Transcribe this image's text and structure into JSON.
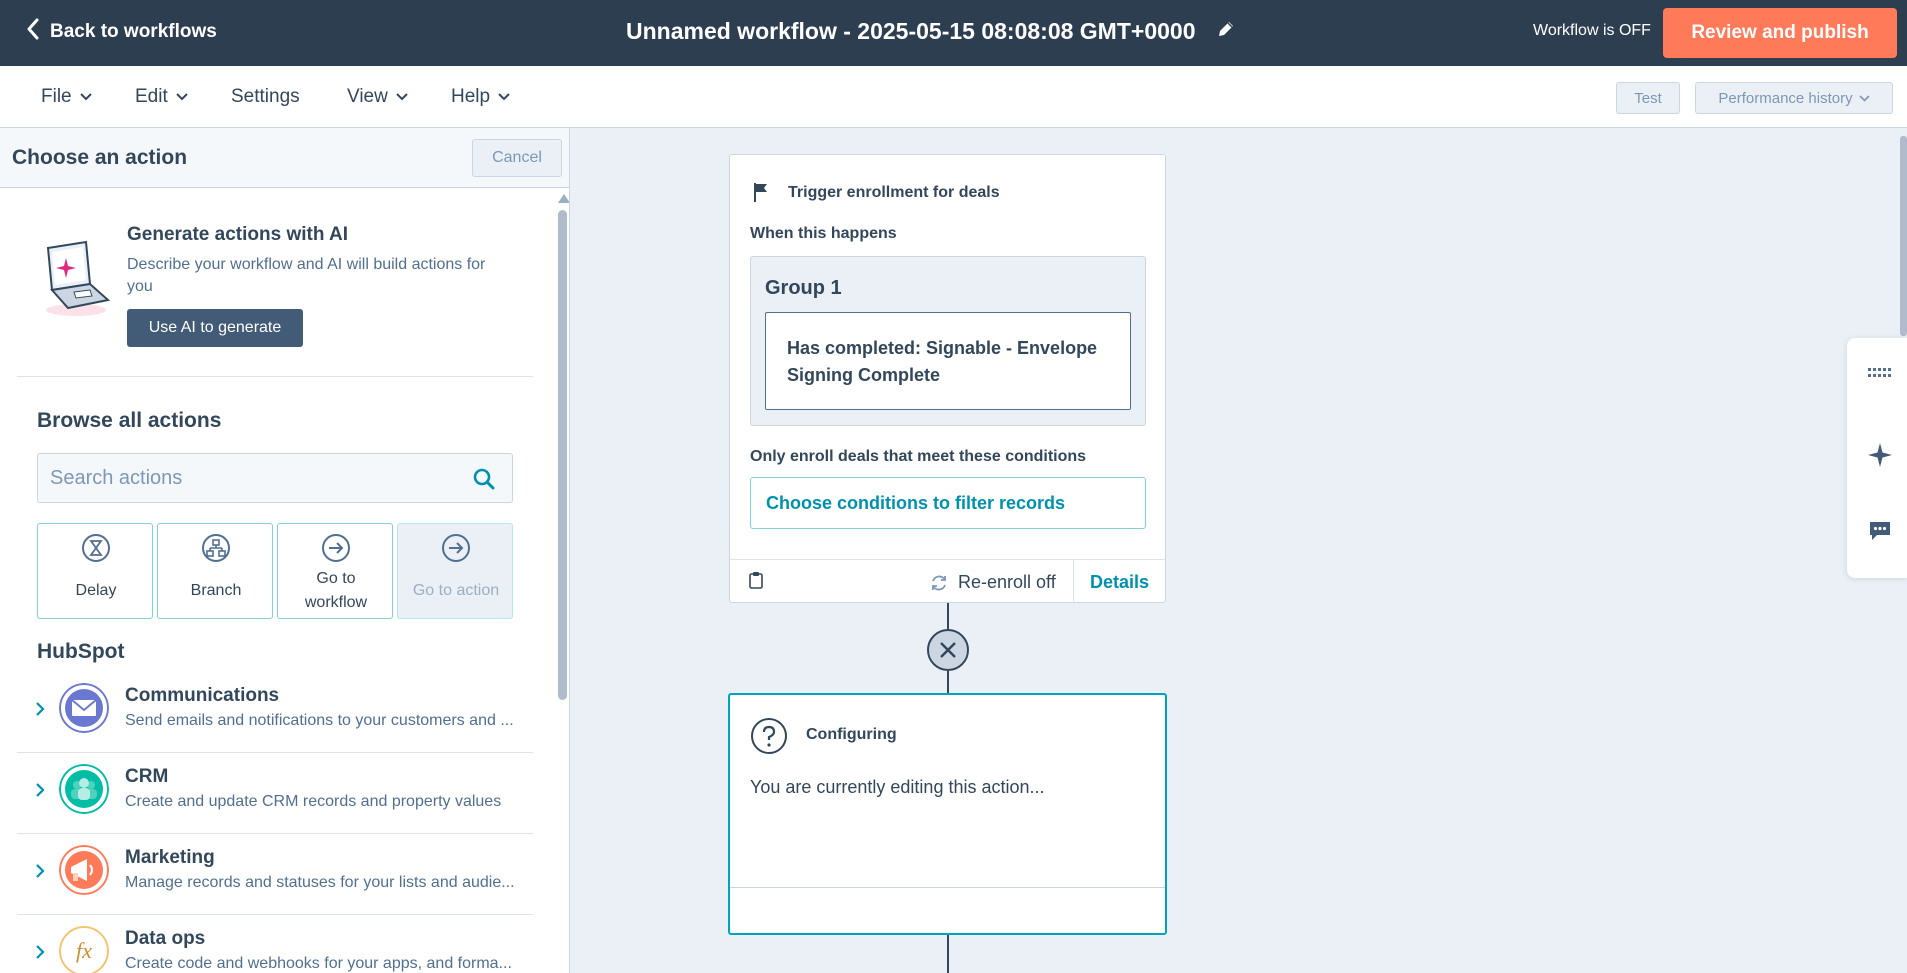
{
  "topbar": {
    "back_label": "Back to workflows",
    "title": "Unnamed workflow - 2025-05-15 08:08:08 GMT+0000",
    "status": "Workflow is OFF",
    "publish_label": "Review and publish"
  },
  "menu": {
    "file": "File",
    "edit": "Edit",
    "settings": "Settings",
    "view": "View",
    "help": "Help",
    "test": "Test",
    "performance": "Performance history"
  },
  "panel": {
    "title": "Choose an action",
    "cancel": "Cancel",
    "ai": {
      "title": "Generate actions with AI",
      "description": "Describe your workflow and AI will build actions for you",
      "button": "Use AI to generate"
    },
    "browse_title": "Browse all actions",
    "search_placeholder": "Search actions",
    "tiles": [
      {
        "label": "Delay",
        "icon": "hourglass-icon"
      },
      {
        "label": "Branch",
        "icon": "branch-icon"
      },
      {
        "label": "Go to workflow",
        "icon": "arrow-circle-icon"
      },
      {
        "label": "Go to action",
        "icon": "arrow-circle-icon",
        "disabled": true
      }
    ],
    "hubspot_title": "HubSpot",
    "categories": [
      {
        "name": "Communications",
        "description": "Send emails and notifications to your customers and ...",
        "icon": "envelope-icon",
        "color": "#6a78d1"
      },
      {
        "name": "CRM",
        "description": "Create and update CRM records and property values",
        "icon": "contacts-icon",
        "color": "#00bda5"
      },
      {
        "name": "Marketing",
        "description": "Manage records and statuses for your lists and audie...",
        "icon": "megaphone-icon",
        "color": "#ff7a59"
      },
      {
        "name": "Data ops",
        "description": "Create code and webhooks for your apps, and forma...",
        "icon": "fx-icon",
        "color": "#f5c26b"
      }
    ]
  },
  "canvas": {
    "trigger": {
      "title": "Trigger enrollment for deals",
      "when_label": "When this happens",
      "group_title": "Group 1",
      "condition": "Has completed: Signable - Envelope Signing Complete",
      "only_label": "Only enroll deals that meet these conditions",
      "filter_button": "Choose conditions to filter records",
      "reenroll": "Re-enroll off",
      "details": "Details"
    },
    "configuring": {
      "title": "Configuring",
      "text": "You are currently editing this action..."
    }
  },
  "colors": {
    "topbar": "#2d3e50",
    "accent": "#ff7a59",
    "link": "#0091ae",
    "selected_border": "#00a4bd"
  }
}
